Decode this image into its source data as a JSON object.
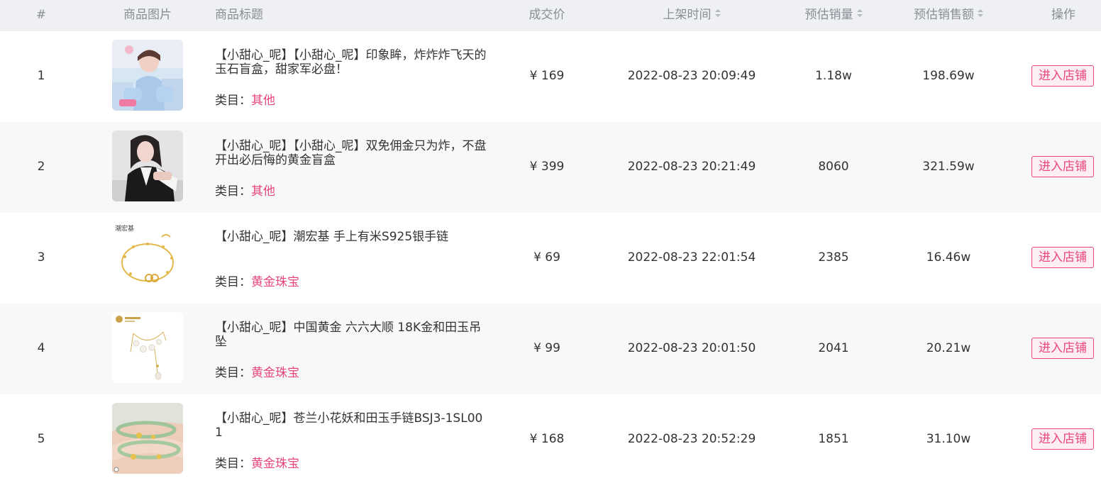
{
  "header": {
    "index": "#",
    "image": "商品图片",
    "title": "商品标题",
    "price": "成交价",
    "listed_time": "上架时间",
    "est_sales": "预估销量",
    "est_revenue": "预估销售额",
    "action": "操作"
  },
  "category_label": "类目：",
  "currency_symbol": "¥",
  "rows": [
    {
      "index": "1",
      "title": "【小甜心_呢】【小甜心_呢】印象眸，炸炸炸飞天的玉石盲盒，甜家军必盘！",
      "category": "其他",
      "price": "169",
      "listed_time": "2022-08-23 20:09:49",
      "est_sales": "1.18w",
      "est_revenue": "198.69w",
      "action": "进入店铺",
      "image_icon": "woman-in-blue-outfit-photo"
    },
    {
      "index": "2",
      "title": "【小甜心_呢】【小甜心_呢】双免佣金只为炸，不盘开出必后悔的黄金盲盒",
      "category": "其他",
      "price": "399",
      "listed_time": "2022-08-23 20:21:49",
      "est_sales": "8060",
      "est_revenue": "321.59w",
      "action": "进入店铺",
      "image_icon": "woman-in-black-blazer-photo"
    },
    {
      "index": "3",
      "title": "【小甜心_呢】潮宏基 手上有米S925银手链",
      "category": "黄金珠宝",
      "price": "69",
      "listed_time": "2022-08-23 22:01:54",
      "est_sales": "2385",
      "est_revenue": "16.46w",
      "action": "进入店铺",
      "image_icon": "gold-bracelet-photo",
      "image_brand_text": "潮宏基"
    },
    {
      "index": "4",
      "title": "【小甜心_呢】中国黄金 六六大顺 18K金和田玉吊坠",
      "category": "黄金珠宝",
      "price": "99",
      "listed_time": "2022-08-23 20:01:50",
      "est_sales": "2041",
      "est_revenue": "20.21w",
      "action": "进入店铺",
      "image_icon": "pearl-pendant-necklace-photo"
    },
    {
      "index": "5",
      "title": "【小甜心_呢】苍兰小花妖和田玉手链BSJ3-1SL001",
      "category": "黄金珠宝",
      "price": "168",
      "listed_time": "2022-08-23 20:52:29",
      "est_sales": "1851",
      "est_revenue": "31.10w",
      "action": "进入店铺",
      "image_icon": "jade-bracelet-on-wrist-photo"
    }
  ],
  "colors": {
    "header_bg": "#eef0f4",
    "accent": "#e8467c",
    "stripe_bg": "#f8f8f8"
  }
}
